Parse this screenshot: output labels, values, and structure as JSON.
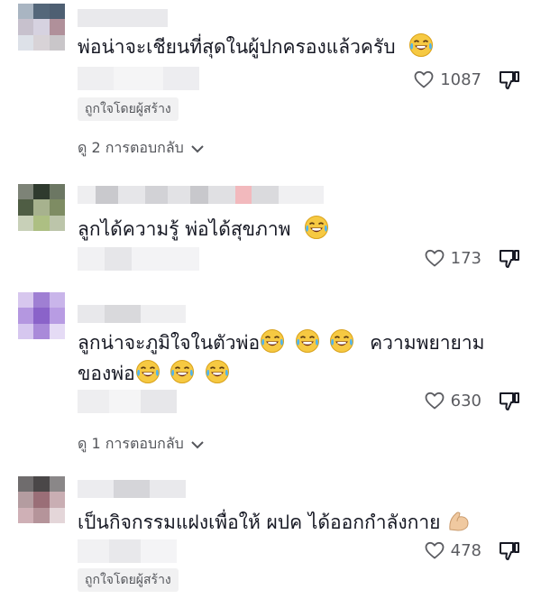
{
  "comments": [
    {
      "text": "พ่อน่าจะเชียนที่สุดในผู้ปกครองแล้วครับ",
      "emoji_count": 1,
      "likes": "1087",
      "badge": "ถูกใจโดยผู้สร้าง",
      "replies": "ดู 2 การตอบกลับ"
    },
    {
      "text": "ลูกได้ความรู้ พ่อได้สุขภาพ",
      "emoji_count": 1,
      "likes": "173"
    },
    {
      "text_line1": "ลูกน่าจะภูมิใจในตัวพ่อ",
      "text_line1_suffix": "ความพยายาม",
      "text_line2": "ของพ่อ",
      "likes": "630",
      "replies": "ดู 1 การตอบกลับ"
    },
    {
      "text": "เป็นกิจกรรมแฝงเพื่อให้ ผปค ได้ออกกำลังกาย",
      "emoji": "flexed-biceps",
      "likes": "478",
      "badge": "ถูกใจโดยผู้สร้าง"
    }
  ],
  "colors": {
    "text": "#161823",
    "secondary": "#5b5c61",
    "badge_bg": "#f1f1f2"
  }
}
